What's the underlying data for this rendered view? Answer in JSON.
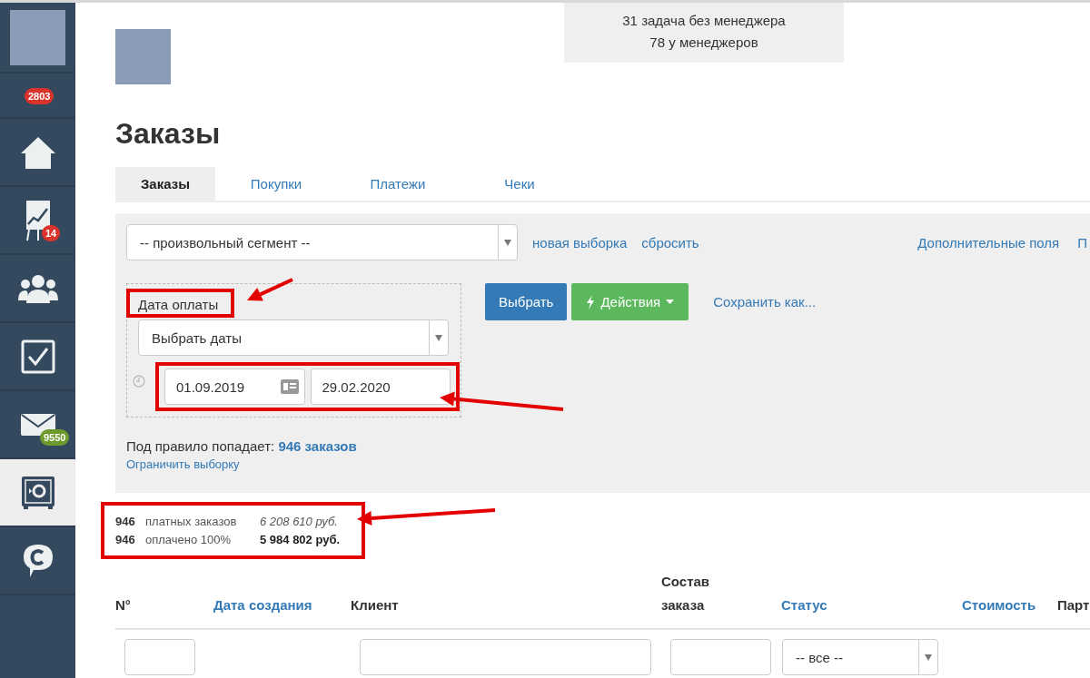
{
  "sidebar": {
    "items": [
      {
        "kind": "avatar",
        "selected": false
      },
      {
        "kind": "notifications",
        "selected": false,
        "badge": "2803",
        "color": "#d9342b"
      },
      {
        "kind": "home",
        "selected": false
      },
      {
        "kind": "chart",
        "selected": false,
        "badge": "14",
        "color": "#d9342b"
      },
      {
        "kind": "people",
        "selected": false
      },
      {
        "kind": "tasks",
        "selected": false
      },
      {
        "kind": "mail",
        "selected": false,
        "badge": "9550",
        "color": "#6e9a2c"
      },
      {
        "kind": "safe",
        "selected": true
      },
      {
        "kind": "chat",
        "selected": false
      }
    ]
  },
  "task_stats": [
    "31 задача без менеджера",
    "78 у менеджеров"
  ],
  "title": "Заказы",
  "tabs": [
    {
      "label": "Заказы",
      "selected": true
    },
    {
      "label": "Покупки",
      "selected": false
    },
    {
      "label": "Платежи",
      "selected": false
    },
    {
      "label": "Чеки",
      "selected": false
    }
  ],
  "filter": {
    "segment": "-- произвольный сегмент --",
    "links": [
      "новая выборка",
      "сбросить"
    ],
    "right_links": [
      "Дополнительные поля",
      "П"
    ],
    "date_label": {
      "text": "Дата оплаты",
      "highlighted": true
    },
    "date_mode": "Выбрать даты",
    "date_range": {
      "from": "01.09.2019",
      "to": "29.02.2020",
      "highlighted": true
    },
    "buttons": [
      {
        "kind": "primary",
        "label": "Выбрать"
      },
      {
        "kind": "actions",
        "label": "Действия"
      }
    ],
    "save_link": "Сохранить как...",
    "match_text": "Под правило попадает: **946 заказов**",
    "limit_link": "Ограничить выборку"
  },
  "summary": {
    "highlighted": true,
    "rows": [
      {
        "count": "946",
        "label": "платных заказов",
        "amount": "6 208 610 руб."
      },
      {
        "count": "946",
        "label": "оплачено 100%",
        "amount": "5 984 802 руб."
      }
    ]
  },
  "table": {
    "columns": [
      {
        "label": "N°",
        "link": false
      },
      {
        "label": "Дата создания",
        "link": true
      },
      {
        "label": "Клиент",
        "link": false
      },
      {
        "label": "Состав заказа",
        "link": false
      },
      {
        "label": "Статус",
        "link": true
      },
      {
        "label": "Стоимость",
        "link": true
      },
      {
        "label": "Парт",
        "link": false
      }
    ],
    "filter_row": [
      {
        "kind": "input"
      },
      {
        "kind": "blank"
      },
      {
        "kind": "input"
      },
      {
        "kind": "input"
      },
      {
        "kind": "select",
        "value": "-- все --"
      }
    ]
  }
}
